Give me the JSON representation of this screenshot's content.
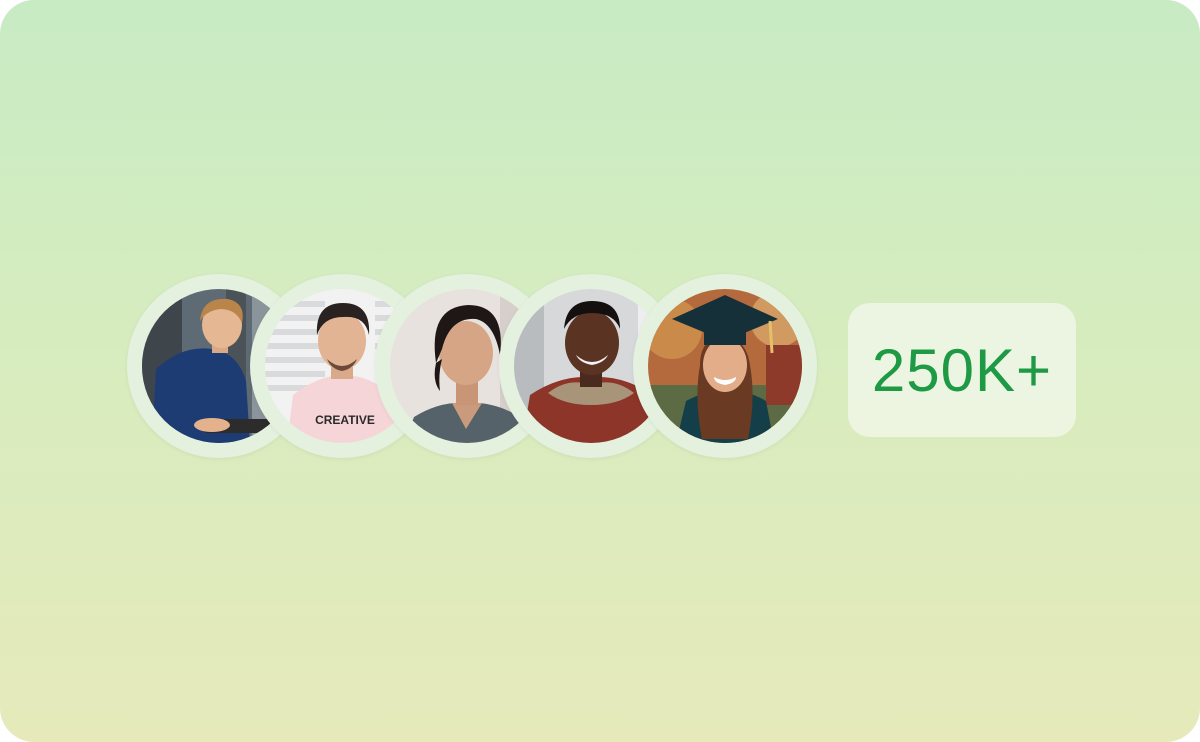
{
  "avatars": [
    {
      "icon": "avatar-person-laptop"
    },
    {
      "icon": "avatar-person-creative-shirt",
      "shirt_text": "CREATIVE"
    },
    {
      "icon": "avatar-person-woman"
    },
    {
      "icon": "avatar-person-hoodie"
    },
    {
      "icon": "avatar-person-graduate"
    }
  ],
  "stats": {
    "count_label": "250K+"
  },
  "colors": {
    "count_text": "#1e9a45",
    "background_top": "#c8ebc4",
    "background_bottom": "#e6eabb"
  }
}
